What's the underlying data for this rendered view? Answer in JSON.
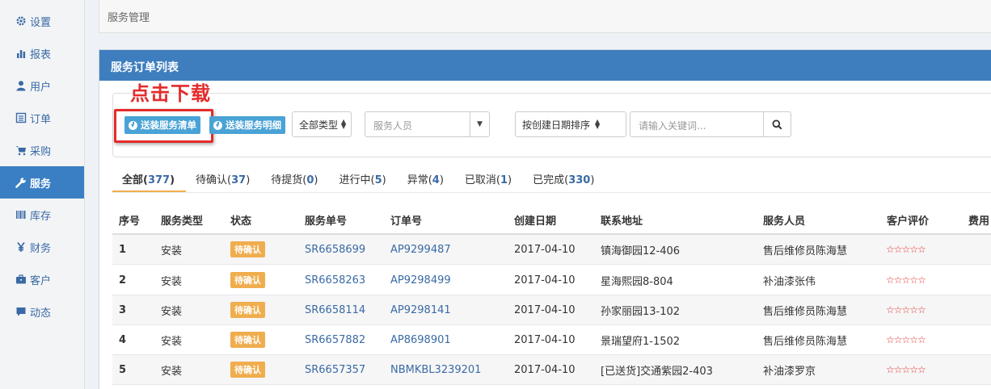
{
  "sidebar": {
    "items": [
      {
        "label": "设置",
        "icon": "gear-icon"
      },
      {
        "label": "报表",
        "icon": "bar-chart-icon"
      },
      {
        "label": "用户",
        "icon": "user-icon"
      },
      {
        "label": "订单",
        "icon": "list-icon"
      },
      {
        "label": "采购",
        "icon": "cart-icon"
      },
      {
        "label": "服务",
        "icon": "wrench-icon"
      },
      {
        "label": "库存",
        "icon": "barcode-icon"
      },
      {
        "label": "财务",
        "icon": "yen-icon"
      },
      {
        "label": "客户",
        "icon": "briefcase-icon"
      },
      {
        "label": "动态",
        "icon": "comment-icon"
      }
    ],
    "active_index": 5
  },
  "breadcrumb": "服务管理",
  "panel": {
    "title": "服务订单列表"
  },
  "annotation": {
    "callout_text": "点击下载",
    "color": "#e42b2b"
  },
  "toolbar": {
    "btn_install_list": "送装服务清单",
    "btn_install_detail": "送装服务明细",
    "type_select": "全部类型",
    "staff_placeholder": "服务人员",
    "sort_select": "按创建日期排序",
    "search_placeholder": "请输入关键词..."
  },
  "tabs": [
    {
      "label": "全部(",
      "count": "377",
      "close": ")"
    },
    {
      "label": "待确认(",
      "count": "37",
      "close": ")"
    },
    {
      "label": "待提货(",
      "count": "0",
      "close": ")"
    },
    {
      "label": "进行中(",
      "count": "5",
      "close": ")"
    },
    {
      "label": "异常(",
      "count": "4",
      "close": ")"
    },
    {
      "label": "已取消(",
      "count": "1",
      "close": ")"
    },
    {
      "label": "已完成(",
      "count": "330",
      "close": ")"
    }
  ],
  "table": {
    "columns": [
      "序号",
      "服务类型",
      "状态",
      "服务单号",
      "订单号",
      "创建日期",
      "联系地址",
      "服务人员",
      "客户评价",
      "费用"
    ],
    "rows": [
      {
        "no": "1",
        "type": "安装",
        "status": "待确认",
        "service_no": "SR6658699",
        "order_no": "AP9299487",
        "date": "2017-04-10",
        "address": "镇海御园12-406",
        "staff": "售后维修员陈海慧",
        "rating": "☆☆☆☆☆"
      },
      {
        "no": "2",
        "type": "安装",
        "status": "待确认",
        "service_no": "SR6658263",
        "order_no": "AP9298499",
        "date": "2017-04-10",
        "address": "星海熙园8-804",
        "staff": "补油漆张伟",
        "rating": "☆☆☆☆☆"
      },
      {
        "no": "3",
        "type": "安装",
        "status": "待确认",
        "service_no": "SR6658114",
        "order_no": "AP9298141",
        "date": "2017-04-10",
        "address": "孙家丽园13-102",
        "staff": "售后维修员陈海慧",
        "rating": "☆☆☆☆☆"
      },
      {
        "no": "4",
        "type": "安装",
        "status": "待确认",
        "service_no": "SR6657882",
        "order_no": "AP8698901",
        "date": "2017-04-10",
        "address": "景瑞望府1-1502",
        "staff": "售后维修员陈海慧",
        "rating": "☆☆☆☆☆"
      },
      {
        "no": "5",
        "type": "安装",
        "status": "待确认",
        "service_no": "SR6657357",
        "order_no": "NBMKBL3239201",
        "date": "2017-04-10",
        "address": "[已送货]交通紫园2-403",
        "staff": "补油漆罗京",
        "rating": "☆☆☆☆☆"
      }
    ]
  }
}
